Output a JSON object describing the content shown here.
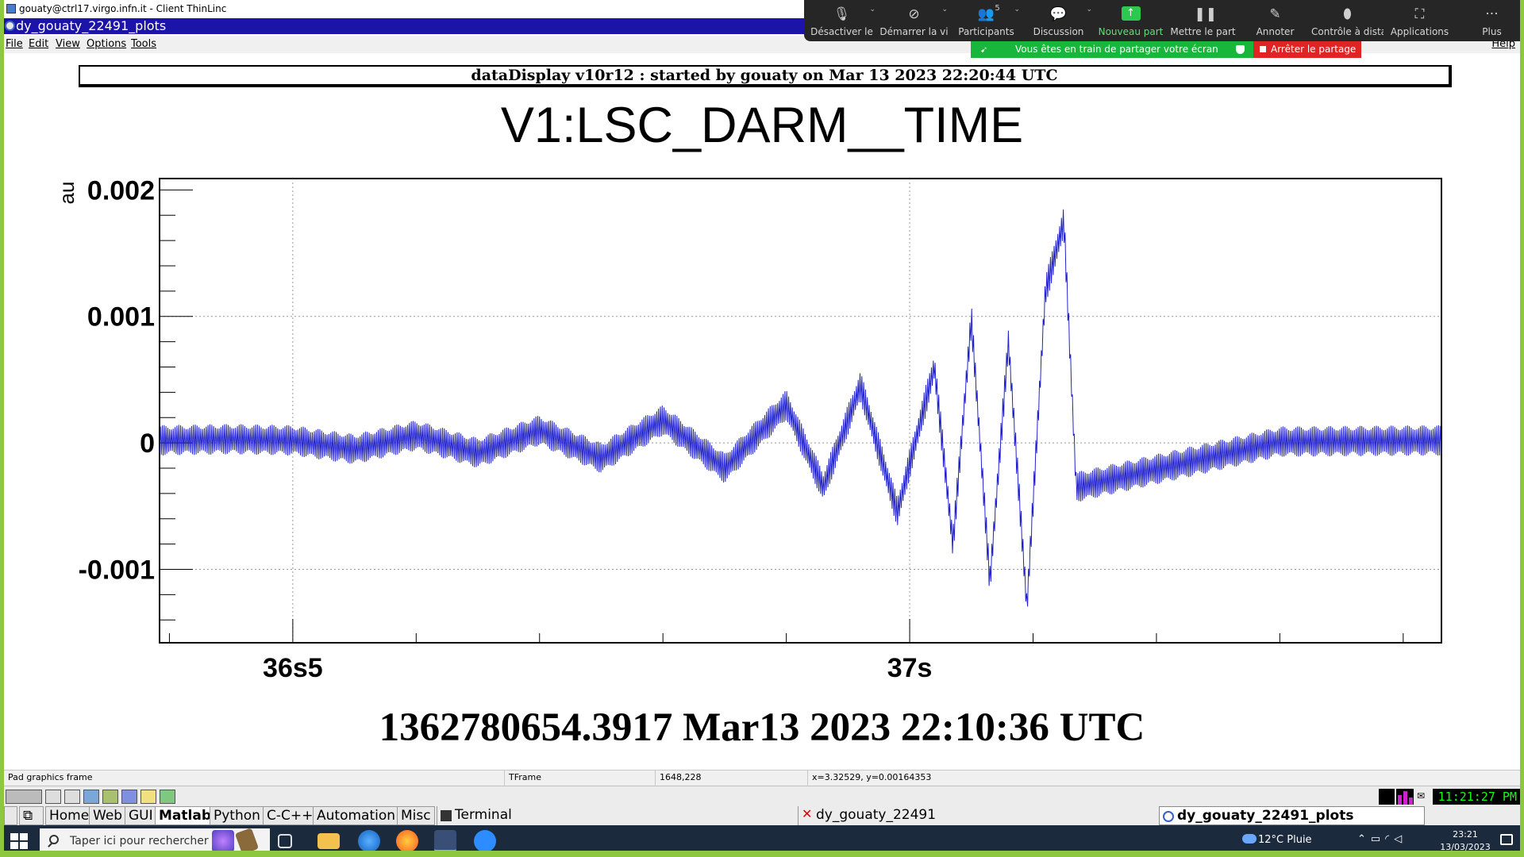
{
  "thinlinc": {
    "title": "gouaty@ctrl17.virgo.infn.it - Client ThinLinc"
  },
  "window": {
    "title": "dy_gouaty_22491_plots",
    "menu": [
      "File",
      "Edit",
      "View",
      "Options",
      "Tools"
    ],
    "help": "Help"
  },
  "zoom": {
    "items": [
      {
        "label": "Désactiver le",
        "icon": "microphone-icon"
      },
      {
        "label": "Démarrer la vi",
        "icon": "video-off-icon"
      },
      {
        "label": "Participants",
        "icon": "participants-icon",
        "count": "5"
      },
      {
        "label": "Discussion",
        "icon": "chat-icon"
      },
      {
        "label": "Nouveau part",
        "icon": "share-screen-icon"
      },
      {
        "label": "Mettre le part",
        "icon": "pause-icon"
      },
      {
        "label": "Annoter",
        "icon": "pencil-icon"
      },
      {
        "label": "Contrôle à distanc",
        "icon": "mouse-icon"
      },
      {
        "label": "Applications",
        "icon": "apps-icon"
      },
      {
        "label": "Plus",
        "icon": "more-icon"
      }
    ],
    "sharing_banner": "Vous êtes en train de partager votre écran",
    "stop_share": "Arrêter le partage"
  },
  "plot": {
    "banner": "dataDisplay v10r12 : started by gouaty on Mar 13 2023 22:20:44 UTC",
    "title": "V1:LSC_DARM__TIME",
    "footer": "1362780654.3917 Mar13 2023 22:10:36 UTC",
    "colors": {
      "trace": "#2222cc",
      "grid": "#999999",
      "frame": "#000000"
    }
  },
  "chart_data": {
    "type": "line",
    "title": "V1:LSC_DARM__TIME",
    "xlabel": "",
    "ylabel": "au",
    "x_tick_labels": [
      "36s5",
      "37s"
    ],
    "x_tick_values": [
      36.5,
      37.0
    ],
    "xlim": [
      36.392,
      37.431
    ],
    "y_tick_labels": [
      "0.002",
      "0.001",
      "0",
      "-0.001"
    ],
    "ylim": [
      -0.00158,
      0.00209
    ],
    "yticks": [
      0.002,
      0.001,
      0,
      -0.001
    ],
    "grid": true,
    "legend": "none",
    "series": [
      {
        "x": [
          36.392,
          36.45,
          36.5,
          36.55,
          36.6,
          36.65,
          36.7,
          36.75,
          36.8,
          36.85,
          36.9,
          36.93,
          36.96,
          36.99,
          37.02,
          37.035,
          37.05,
          37.065,
          37.08,
          37.095,
          37.11,
          37.125,
          37.135,
          37.3,
          37.431
        ],
        "y": [
          2e-05,
          3e-05,
          2e-05,
          -5e-05,
          6e-05,
          -8e-05,
          0.0001,
          -0.00012,
          0.00018,
          -0.0002,
          0.0003,
          -0.00035,
          0.00045,
          -0.00055,
          0.0006,
          -0.0008,
          0.00098,
          -0.0011,
          0.0008,
          -0.0013,
          0.0012,
          0.00175,
          -0.00035,
          1e-05,
          2e-05
        ]
      }
    ]
  },
  "status": {
    "fields": [
      "Pad graphics frame",
      "TFrame",
      "1648,228",
      "x=3.32529, y=0.00164353"
    ]
  },
  "xtaskbar": {
    "menus": [
      "Home",
      "Web",
      "GUI",
      "Matlab",
      "Python",
      "C-C++",
      "Automation",
      "Misc"
    ],
    "windows": [
      "Terminal",
      "dy_gouaty_22491",
      "dy_gouaty_22491_plots"
    ],
    "clock": "11:21:27 PM"
  },
  "windows_taskbar": {
    "search_placeholder": "Taper ici pour rechercher",
    "weather": "12°C  Pluie",
    "time": "23:21",
    "date": "13/03/2023"
  }
}
